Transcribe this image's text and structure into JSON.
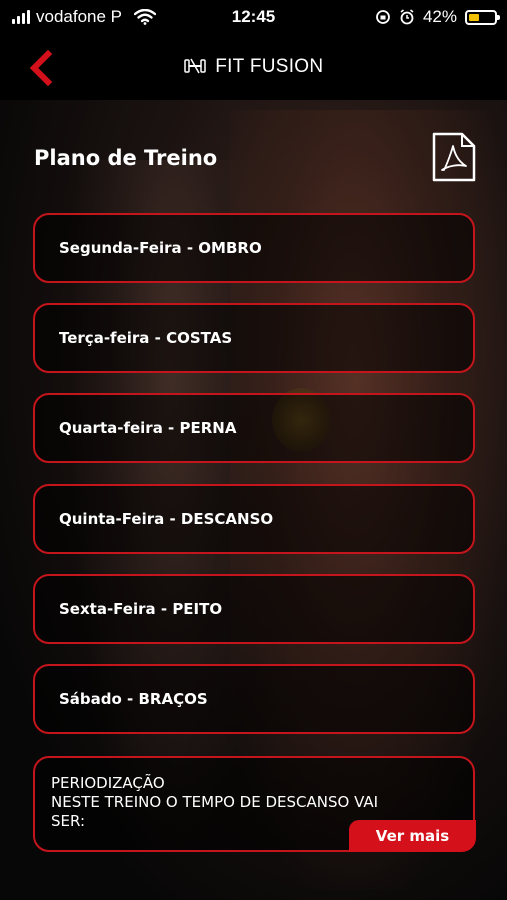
{
  "status_bar": {
    "carrier": "vodafone P",
    "time": "12:45",
    "battery_percent": "42%",
    "battery_level": 0.42
  },
  "header": {
    "brand": "FIT FUSION"
  },
  "page": {
    "title": "Plano de Treino"
  },
  "days": [
    {
      "label": "Segunda-Feira - OMBRO"
    },
    {
      "label": "Terça-feira - COSTAS"
    },
    {
      "label": "Quarta-feira - PERNA"
    },
    {
      "label": "Quinta-Feira - DESCANSO"
    },
    {
      "label": "Sexta-Feira - PEITO"
    },
    {
      "label": "Sábado - BRAÇOS"
    }
  ],
  "periodization": {
    "lines": [
      "PERIODIZAÇÃO",
      "NESTE TREINO O TEMPO DE DESCANSO VAI",
      "SER:"
    ],
    "more_label": "Ver mais"
  },
  "colors": {
    "accent": "#c4151c",
    "button": "#d4101a",
    "battery": "#f2c200"
  }
}
